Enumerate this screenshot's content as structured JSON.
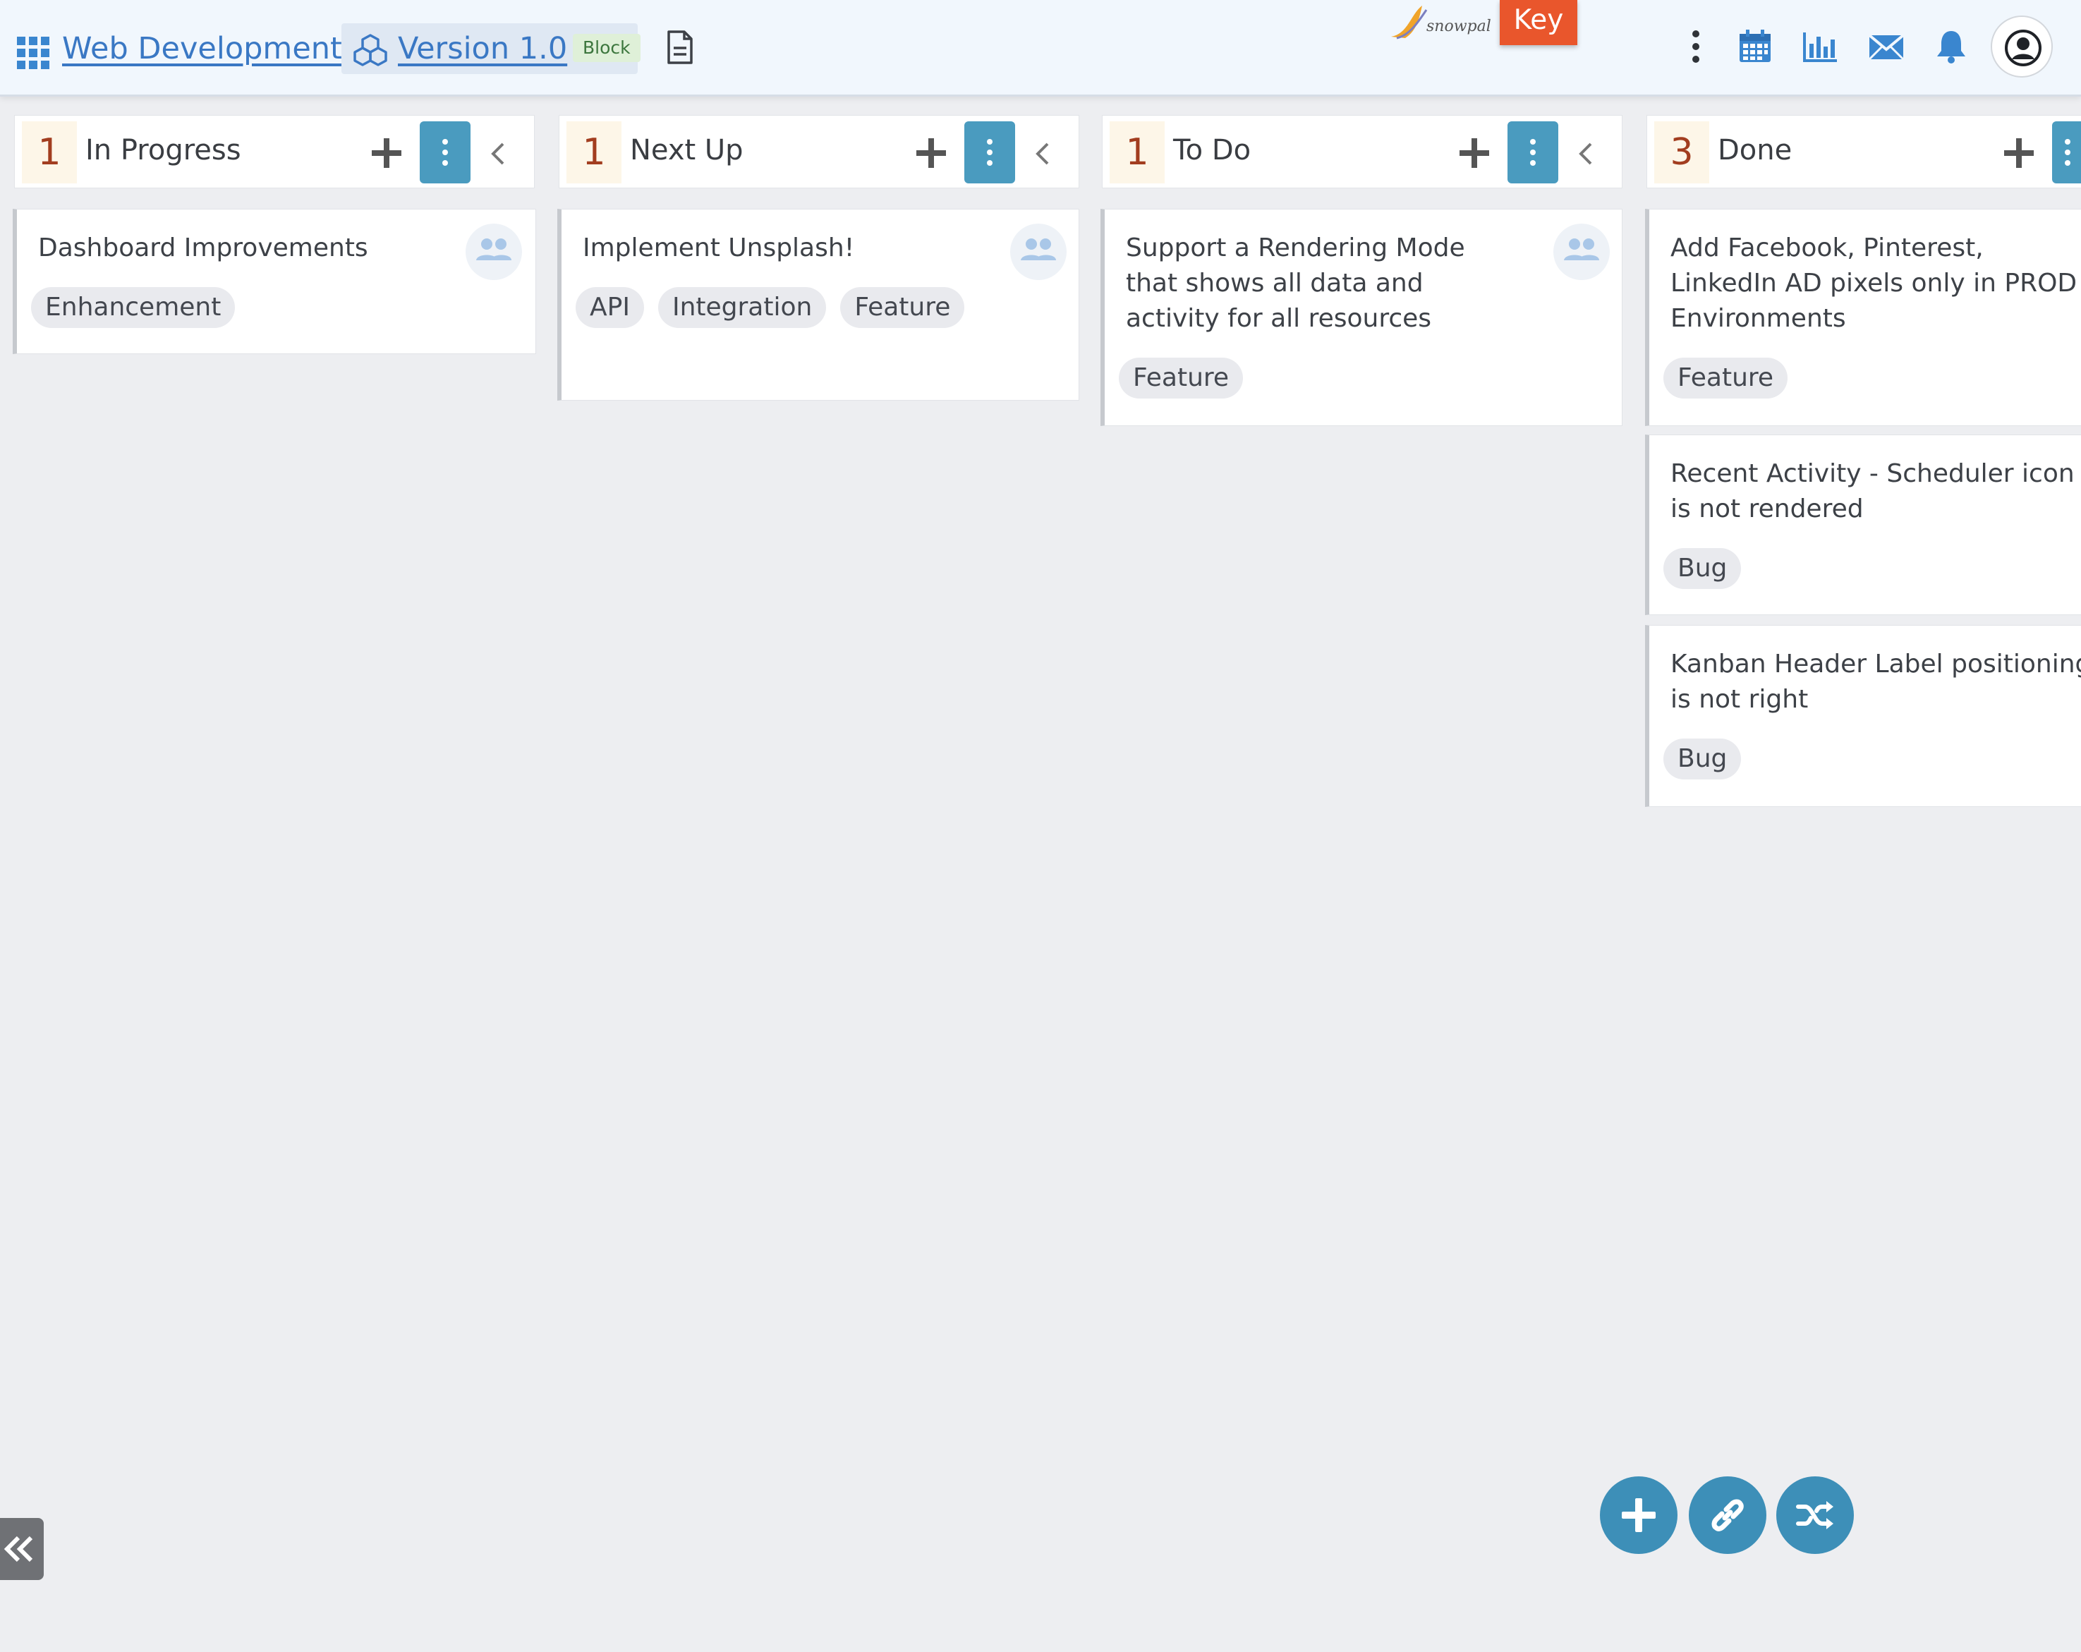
{
  "header": {
    "project": "Web Development",
    "version": "Version 1.0",
    "version_badge": "Block",
    "key_label": "Key",
    "logo_text": "snowpal",
    "icons": [
      "grid-icon",
      "cubes-icon",
      "document-icon",
      "kebab-icon",
      "calendar-icon",
      "chart-icon",
      "mail-icon",
      "bell-icon",
      "user-circle-icon"
    ]
  },
  "colors": {
    "accent": "#4a9bbf",
    "fab": "#3d8fb8",
    "key": "#e9562c",
    "count_text": "#a23d1f",
    "link": "#3a78c4"
  },
  "columns": [
    {
      "title": "In Progress",
      "count": "1",
      "cards": [
        {
          "title": "Dashboard Improvements",
          "tags": [
            "Enhancement"
          ]
        }
      ]
    },
    {
      "title": "Next Up",
      "count": "1",
      "cards": [
        {
          "title": "Implement Unsplash!",
          "tags": [
            "API",
            "Integration",
            "Feature"
          ]
        }
      ]
    },
    {
      "title": "To Do",
      "count": "1",
      "cards": [
        {
          "title": "Support a Rendering Mode that shows all data and activity for all resources",
          "tags": [
            "Feature"
          ]
        }
      ]
    },
    {
      "title": "Done",
      "count": "3",
      "cards": [
        {
          "title": "Add Facebook, Pinterest, LinkedIn AD pixels only in PROD Environments",
          "tags": [
            "Feature"
          ]
        },
        {
          "title": "Recent Activity - Scheduler icon is not rendered",
          "tags": [
            "Bug"
          ]
        },
        {
          "title": "Kanban Header Label positioning is not right",
          "tags": [
            "Bug"
          ]
        }
      ]
    }
  ]
}
